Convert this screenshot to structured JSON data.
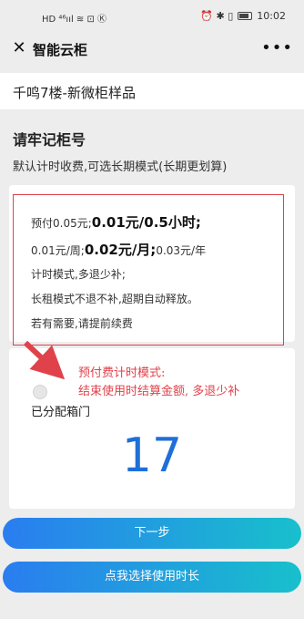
{
  "status_bar": {
    "left_icons": "HD ⁴⁶ııl ≋ ⊡ Ⓚ",
    "right_icons": "⏰ ✱ ▯",
    "time": "10:02"
  },
  "nav": {
    "close_icon": "close-icon",
    "title": "智能云柜",
    "more_icon": "more-icon"
  },
  "product": {
    "name": "千鸣7楼-新微柜样品"
  },
  "locker": {
    "remember_title": "请牢记柜号",
    "default_note": "默认计时收费,可选长期模式(长期更划算)"
  },
  "pricing": {
    "line1_prefix": "预付0.05元;",
    "line1_bold": "0.01元/0.5小时;",
    "line2_prefix": "0.01元/周;",
    "line2_bold": "0.02元/月;",
    "line2_suffix": "0.03元/年",
    "line3": "计时模式,多退少补;",
    "line4": "长租模式不退不补,超期自动释放。",
    "line5": "若有需要,请提前续费"
  },
  "annotation": {
    "line1": "预付费计时模式:",
    "line2": "结束使用时结算金额, 多退少补",
    "color": "#e0424b"
  },
  "allocation": {
    "label": "已分配箱门",
    "number": "17"
  },
  "buttons": {
    "next": "下一步",
    "choose_duration": "点我选择使用时长"
  },
  "colors": {
    "accent_start": "#2a7df0",
    "accent_end": "#18c0cc",
    "number": "#1f6fd8",
    "highlight_box": "#e0424b"
  }
}
